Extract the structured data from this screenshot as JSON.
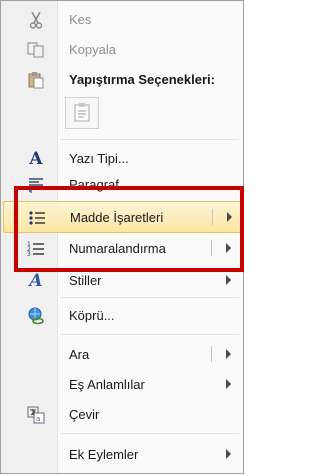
{
  "menu": {
    "cut": {
      "label": "Kes",
      "icon": "scissors-icon"
    },
    "copy": {
      "label": "Kopyala",
      "icon": "copy-icon"
    },
    "paste_header": {
      "label": "Yapıştırma Seçenekleri:",
      "icon": "paste-icon"
    },
    "font": {
      "label": "Yazı Tipi...",
      "icon": "font-icon"
    },
    "paragraph": {
      "label": "Paragraf...",
      "icon": "paragraph-icon"
    },
    "bullets": {
      "label": "Madde İşaretleri",
      "icon": "bulleted-list-icon"
    },
    "numbering": {
      "label": "Numaralandırma",
      "icon": "numbered-list-icon"
    },
    "styles": {
      "label": "Stiller",
      "icon": "styles-icon"
    },
    "hyperlink": {
      "label": "Köprü...",
      "icon": "hyperlink-icon"
    },
    "lookup": {
      "label": "Ara"
    },
    "synonyms": {
      "label": "Eş Anlamlılar"
    },
    "translate": {
      "label": "Çevir",
      "icon": "translate-icon"
    },
    "addins": {
      "label": "Ek Eylemler"
    }
  },
  "colors": {
    "highlight_border": "#e5c365",
    "annotation_red": "#c40000"
  }
}
